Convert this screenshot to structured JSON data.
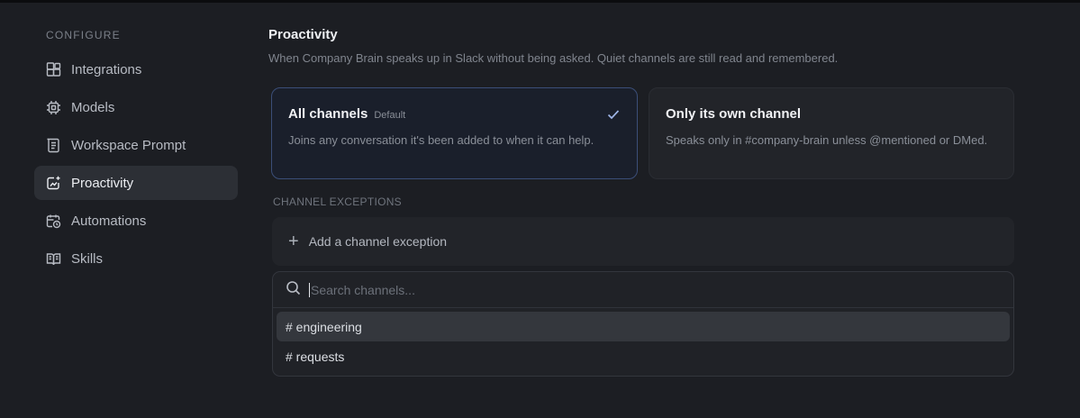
{
  "sidebar": {
    "section_label": "CONFIGURE",
    "items": [
      {
        "label": "Integrations",
        "icon": "integrations-icon",
        "active": false
      },
      {
        "label": "Models",
        "icon": "chip-icon",
        "active": false
      },
      {
        "label": "Workspace Prompt",
        "icon": "prompt-icon",
        "active": false
      },
      {
        "label": "Proactivity",
        "icon": "sparkle-chat-icon",
        "active": true
      },
      {
        "label": "Automations",
        "icon": "calendar-clock-icon",
        "active": false
      },
      {
        "label": "Skills",
        "icon": "book-icon",
        "active": false
      }
    ]
  },
  "main": {
    "title": "Proactivity",
    "description": "When Company Brain speaks up in Slack without being asked. Quiet channels are still read and remembered.",
    "options": [
      {
        "title": "All channels",
        "tag": "Default",
        "description": "Joins any conversation it's been added to when it can help.",
        "selected": true
      },
      {
        "title": "Only its own channel",
        "tag": "",
        "description": "Speaks only in #company-brain unless @mentioned or DMed.",
        "selected": false
      }
    ],
    "exceptions_label": "CHANNEL EXCEPTIONS",
    "add_exception_label": "Add a channel exception",
    "search": {
      "placeholder": "Search channels...",
      "value": ""
    },
    "channels": [
      "# engineering",
      "# requests"
    ]
  },
  "colors": {
    "accent_border": "#3b4e78",
    "check": "#9fb6e8",
    "background": "#1c1e23"
  }
}
